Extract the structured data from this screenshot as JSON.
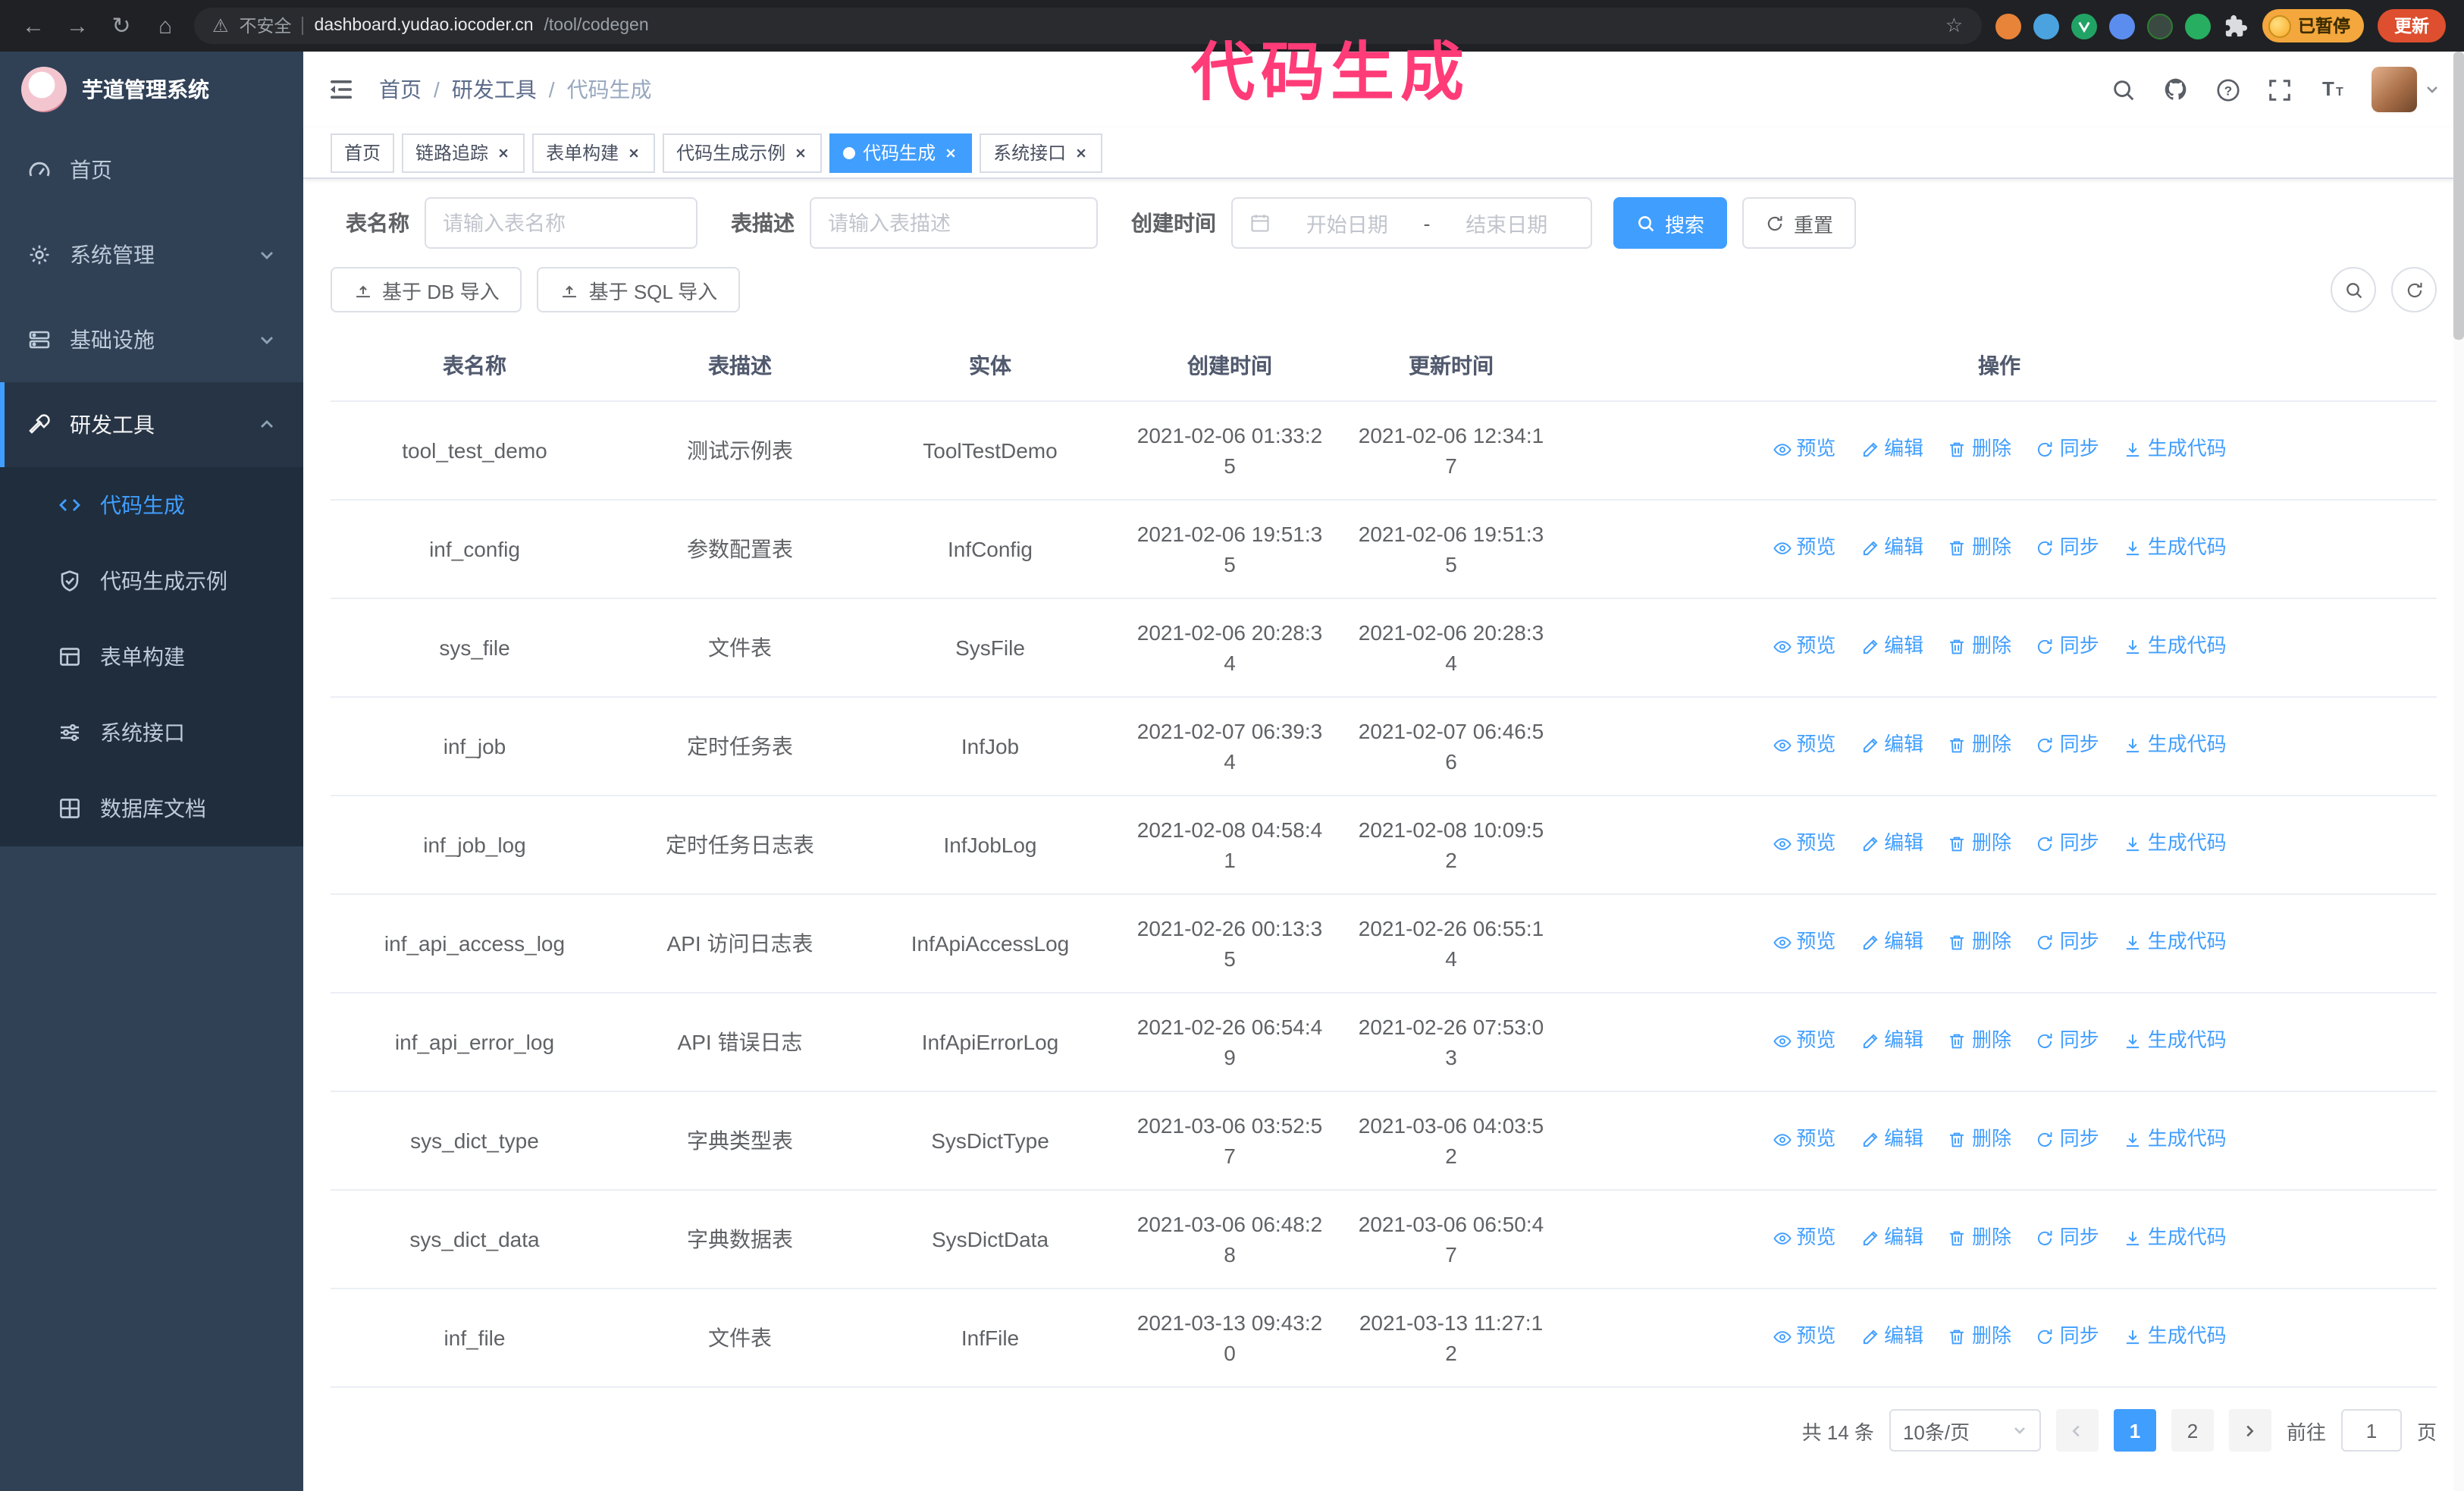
{
  "annotation": {
    "text": "代码生成"
  },
  "colors": {
    "primary": "#409eff",
    "sidebar_bg": "#304156",
    "submenu_bg": "#1f2d3d",
    "annotation_pink": "#ff3c78"
  },
  "browser": {
    "security_label": "不安全",
    "url_host": "dashboard.yudao.iocoder.cn",
    "url_path": "/tool/codegen",
    "paused_badge": "已暂停",
    "update_button": "更新"
  },
  "sidebar": {
    "logo_title": "芋道管理系统",
    "menu": {
      "home": "首页",
      "system": "系统管理",
      "infra": "基础设施",
      "dev_tools": "研发工具"
    },
    "submenu": {
      "codegen": "代码生成",
      "codegen_demo": "代码生成示例",
      "form_builder": "表单构建",
      "system_api": "系统接口",
      "db_doc": "数据库文档"
    }
  },
  "breadcrumb": {
    "home": "首页",
    "section": "研发工具",
    "current": "代码生成",
    "separator": "/"
  },
  "tabs": {
    "home": "首页",
    "trace": "链路追踪",
    "form": "表单构建",
    "codegen_demo": "代码生成示例",
    "codegen": "代码生成",
    "api": "系统接口"
  },
  "filters": {
    "table_name_label": "表名称",
    "table_name_placeholder": "请输入表名称",
    "table_desc_label": "表描述",
    "table_desc_placeholder": "请输入表描述",
    "create_time_label": "创建时间",
    "date_start_placeholder": "开始日期",
    "date_separator": "-",
    "date_end_placeholder": "结束日期",
    "search_button": "搜索",
    "reset_button": "重置"
  },
  "toolbar": {
    "import_db": "基于 DB 导入",
    "import_sql": "基于 SQL 导入"
  },
  "table": {
    "columns": [
      "表名称",
      "表描述",
      "实体",
      "创建时间",
      "更新时间",
      "操作"
    ],
    "actions": [
      "预览",
      "编辑",
      "删除",
      "同步",
      "生成代码"
    ],
    "rows": [
      {
        "name": "tool_test_demo",
        "desc": "测试示例表",
        "entity": "ToolTestDemo",
        "created": "2021-02-06 01:33:25",
        "updated": "2021-02-06 12:34:17"
      },
      {
        "name": "inf_config",
        "desc": "参数配置表",
        "entity": "InfConfig",
        "created": "2021-02-06 19:51:35",
        "updated": "2021-02-06 19:51:35"
      },
      {
        "name": "sys_file",
        "desc": "文件表",
        "entity": "SysFile",
        "created": "2021-02-06 20:28:34",
        "updated": "2021-02-06 20:28:34"
      },
      {
        "name": "inf_job",
        "desc": "定时任务表",
        "entity": "InfJob",
        "created": "2021-02-07 06:39:34",
        "updated": "2021-02-07 06:46:56"
      },
      {
        "name": "inf_job_log",
        "desc": "定时任务日志表",
        "entity": "InfJobLog",
        "created": "2021-02-08 04:58:41",
        "updated": "2021-02-08 10:09:52"
      },
      {
        "name": "inf_api_access_log",
        "desc": "API 访问日志表",
        "entity": "InfApiAccessLog",
        "created": "2021-02-26 00:13:35",
        "updated": "2021-02-26 06:55:14"
      },
      {
        "name": "inf_api_error_log",
        "desc": "API 错误日志",
        "entity": "InfApiErrorLog",
        "created": "2021-02-26 06:54:49",
        "updated": "2021-02-26 07:53:03"
      },
      {
        "name": "sys_dict_type",
        "desc": "字典类型表",
        "entity": "SysDictType",
        "created": "2021-03-06 03:52:57",
        "updated": "2021-03-06 04:03:52"
      },
      {
        "name": "sys_dict_data",
        "desc": "字典数据表",
        "entity": "SysDictData",
        "created": "2021-03-06 06:48:28",
        "updated": "2021-03-06 06:50:47"
      },
      {
        "name": "inf_file",
        "desc": "文件表",
        "entity": "InfFile",
        "created": "2021-03-13 09:43:20",
        "updated": "2021-03-13 11:27:12"
      }
    ]
  },
  "pagination": {
    "total": "共 14 条",
    "page_size": "10条/页",
    "pages": [
      "1",
      "2"
    ],
    "goto_label": "前往",
    "goto_value": "1",
    "unit_label": "页"
  }
}
